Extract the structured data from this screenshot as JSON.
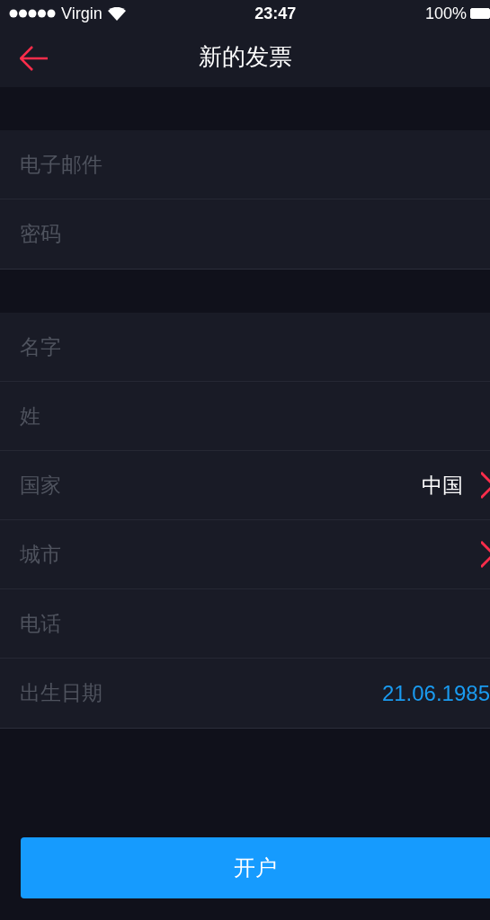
{
  "status_bar": {
    "carrier": "Virgin",
    "time": "23:47",
    "battery": "100%"
  },
  "nav": {
    "title": "新的发票"
  },
  "groups": [
    {
      "fields": [
        {
          "kind": "input",
          "placeholder": "电子邮件"
        },
        {
          "kind": "input",
          "placeholder": "密码"
        }
      ]
    },
    {
      "fields": [
        {
          "kind": "input",
          "placeholder": "名字"
        },
        {
          "kind": "input",
          "placeholder": "姓"
        },
        {
          "kind": "select",
          "placeholder": "国家",
          "value": "中国"
        },
        {
          "kind": "select",
          "placeholder": "城市"
        },
        {
          "kind": "input",
          "placeholder": "电话"
        },
        {
          "kind": "date",
          "placeholder": "出生日期",
          "value": "21.06.1985"
        }
      ]
    }
  ],
  "submit_button": "开户"
}
